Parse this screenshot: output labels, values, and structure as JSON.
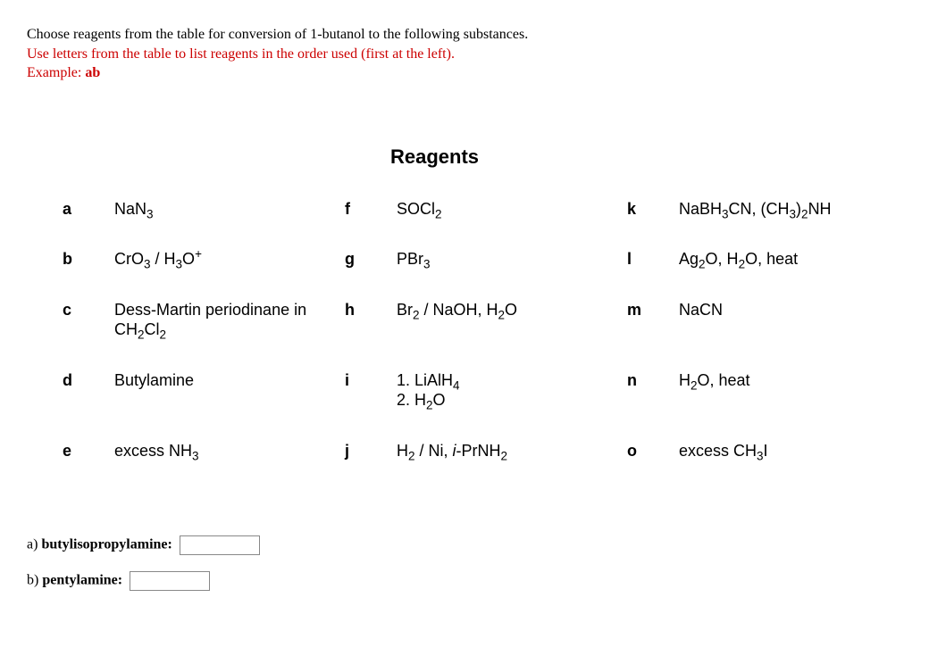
{
  "instructions": {
    "line1": "Choose reagents from the table for conversion of 1-butanol to the following substances.",
    "line2": "Use letters from the table to list reagents in the order used (first at the left).",
    "line3_prefix": "Example: ",
    "line3_bold": "ab"
  },
  "reagents_title": "Reagents",
  "reagents": {
    "a": {
      "letter": "a",
      "html": "NaN<sub>3</sub>"
    },
    "b": {
      "letter": "b",
      "html": "CrO<sub>3</sub> / H<sub>3</sub>O<sup>+</sup>"
    },
    "c": {
      "letter": "c",
      "html": "Dess-Martin periodinane in CH<sub>2</sub>Cl<sub>2</sub>"
    },
    "d": {
      "letter": "d",
      "html": "Butylamine"
    },
    "e": {
      "letter": "e",
      "html": "excess NH<sub>3</sub>"
    },
    "f": {
      "letter": "f",
      "html": "SOCl<sub>2</sub>"
    },
    "g": {
      "letter": "g",
      "html": "PBr<sub>3</sub>"
    },
    "h": {
      "letter": "h",
      "html": "Br<sub>2</sub> / NaOH, H<sub>2</sub>O"
    },
    "i": {
      "letter": "i",
      "html": "1. LiAlH<sub>4</sub><br>2. H<sub>2</sub>O"
    },
    "j": {
      "letter": "j",
      "html": "H<sub>2</sub> / Ni, <span class='i'>i</span>-PrNH<sub>2</sub>"
    },
    "k": {
      "letter": "k",
      "html": "NaBH<sub>3</sub>CN, (CH<sub>3</sub>)<sub>2</sub>NH"
    },
    "l": {
      "letter": "l",
      "html": "Ag<sub>2</sub>O, H<sub>2</sub>O, heat"
    },
    "m": {
      "letter": "m",
      "html": "NaCN"
    },
    "n": {
      "letter": "n",
      "html": "H<sub>2</sub>O, heat"
    },
    "o": {
      "letter": "o",
      "html": "excess CH<sub>3</sub>I"
    }
  },
  "questions": [
    {
      "prefix": "a) ",
      "bold": "butylisopropylamine:",
      "value": ""
    },
    {
      "prefix": "b) ",
      "bold": "pentylamine:",
      "value": ""
    }
  ]
}
